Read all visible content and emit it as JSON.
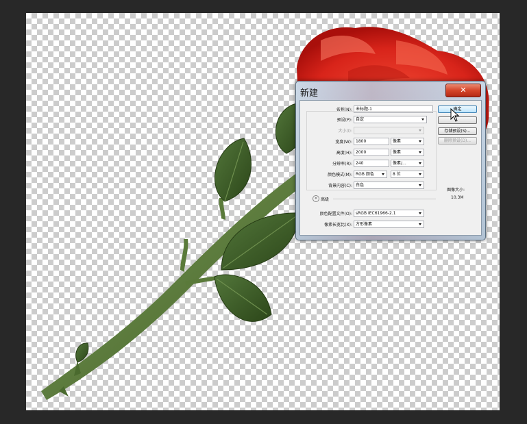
{
  "dialog": {
    "title": "新建",
    "close_icon": "✕",
    "name": {
      "label": "名称(N):",
      "value": "未标题-1"
    },
    "preset": {
      "label": "预设(P):",
      "value": "自定"
    },
    "size": {
      "label": "大小(I):",
      "value": ""
    },
    "width": {
      "label": "宽度(W):",
      "value": "1800",
      "unit": "像素"
    },
    "height": {
      "label": "高度(H):",
      "value": "2000",
      "unit": "像素"
    },
    "resolution": {
      "label": "分辨率(R):",
      "value": "240",
      "unit": "像素/..."
    },
    "color_mode": {
      "label": "颜色模式(M):",
      "value": "RGB 颜色",
      "bits": "8 位"
    },
    "background": {
      "label": "背景内容(C):",
      "value": "白色"
    },
    "advanced": {
      "label": "高级"
    },
    "color_profile": {
      "label": "颜色配置文件(O):",
      "value": "sRGB IEC61966-2.1"
    },
    "pixel_aspect": {
      "label": "像素长宽比(X):",
      "value": "方形像素"
    },
    "buttons": {
      "ok": "确定",
      "cancel": "",
      "save_preset": "存储预设(S)...",
      "delete_preset": "删除预设(D)..."
    },
    "image_size": {
      "label": "图像大小:",
      "value": "10.3M"
    }
  },
  "colors": {
    "workspace": "#282828",
    "rose_red": "#d9251c",
    "leaf_green": "#3b5a25",
    "stem_green": "#55773a"
  },
  "icons": [
    "close-icon",
    "chevron-down-icon",
    "collapse-icon",
    "mouse-cursor-icon"
  ]
}
